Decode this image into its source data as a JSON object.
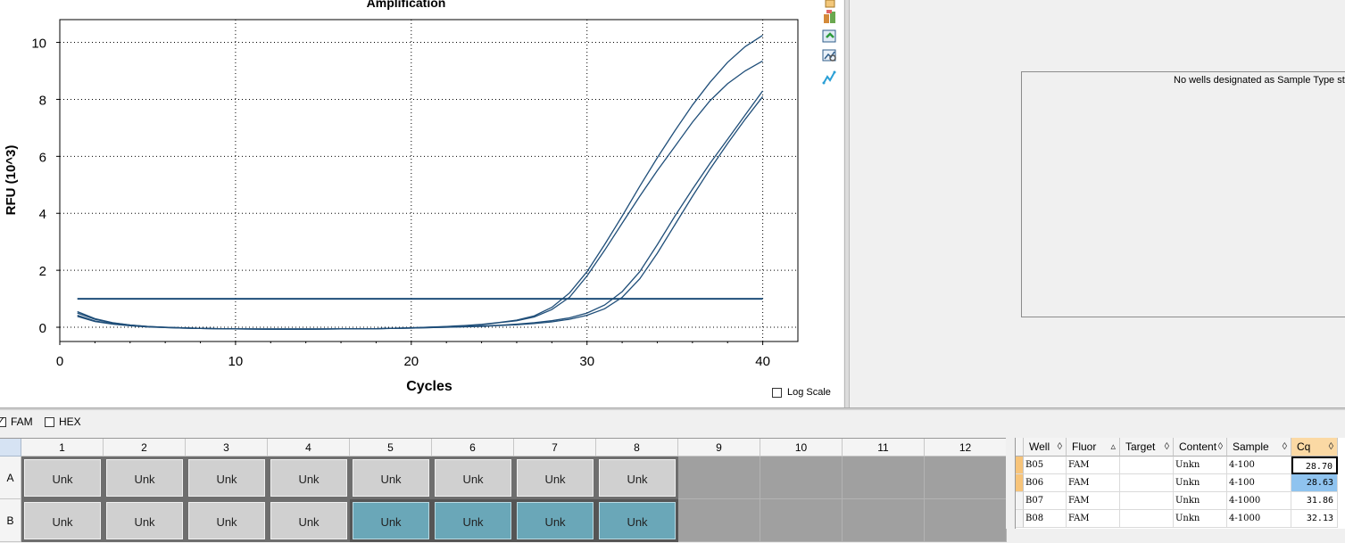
{
  "chart": {
    "title": "Amplification",
    "xlabel": "Cycles",
    "ylabel": "RFU (10^3)",
    "log_scale_label": "Log Scale",
    "log_scale_checked": false
  },
  "chart_data": {
    "type": "line",
    "title": "Amplification",
    "xlabel": "Cycles",
    "ylabel": "RFU (10^3)",
    "xlim": [
      0,
      42
    ],
    "ylim": [
      -0.5,
      10.8
    ],
    "xticks": [
      0,
      10,
      20,
      30,
      40
    ],
    "yticks": [
      0,
      2,
      4,
      6,
      8,
      10
    ],
    "grid": true,
    "threshold": 1.0,
    "line_color": "#1f4e79",
    "series": [
      {
        "x": [
          1,
          2,
          3,
          4,
          5,
          6,
          7,
          8,
          9,
          10,
          12,
          14,
          16,
          18,
          20,
          22,
          23,
          24,
          25,
          26,
          27,
          28,
          29,
          30,
          31,
          32,
          33,
          34,
          35,
          36,
          37,
          38,
          39,
          40
        ],
        "y": [
          0.5,
          0.28,
          0.15,
          0.08,
          0.03,
          0,
          -0.02,
          -0.04,
          -0.05,
          -0.06,
          -0.06,
          -0.06,
          -0.06,
          -0.05,
          -0.02,
          0.03,
          0.06,
          0.1,
          0.17,
          0.25,
          0.4,
          0.7,
          1.2,
          1.95,
          2.9,
          3.9,
          4.95,
          5.95,
          6.9,
          7.8,
          8.6,
          9.3,
          9.85,
          10.25
        ]
      },
      {
        "x": [
          1,
          2,
          3,
          4,
          5,
          6,
          7,
          8,
          9,
          10,
          12,
          14,
          16,
          18,
          20,
          22,
          23,
          24,
          25,
          26,
          27,
          28,
          29,
          30,
          31,
          32,
          33,
          34,
          35,
          36,
          37,
          38,
          39,
          40
        ],
        "y": [
          0.42,
          0.22,
          0.12,
          0.06,
          0.02,
          -0.01,
          -0.03,
          -0.04,
          -0.05,
          -0.06,
          -0.06,
          -0.06,
          -0.06,
          -0.05,
          -0.02,
          0.02,
          0.05,
          0.09,
          0.16,
          0.23,
          0.36,
          0.62,
          1.05,
          1.8,
          2.7,
          3.65,
          4.6,
          5.5,
          6.35,
          7.2,
          7.95,
          8.55,
          9.0,
          9.35
        ]
      },
      {
        "x": [
          1,
          2,
          3,
          4,
          5,
          6,
          7,
          8,
          9,
          10,
          12,
          14,
          16,
          18,
          20,
          22,
          24,
          25,
          26,
          27,
          28,
          29,
          30,
          31,
          32,
          33,
          34,
          35,
          36,
          37,
          38,
          39,
          40
        ],
        "y": [
          0.55,
          0.3,
          0.16,
          0.08,
          0.03,
          0,
          -0.02,
          -0.04,
          -0.05,
          -0.06,
          -0.07,
          -0.07,
          -0.06,
          -0.05,
          -0.03,
          0,
          0.04,
          0.07,
          0.11,
          0.16,
          0.23,
          0.33,
          0.5,
          0.78,
          1.25,
          1.95,
          2.9,
          3.9,
          4.85,
          5.75,
          6.6,
          7.45,
          8.3
        ]
      },
      {
        "x": [
          1,
          2,
          3,
          4,
          5,
          6,
          7,
          8,
          9,
          10,
          12,
          14,
          16,
          18,
          20,
          22,
          24,
          25,
          26,
          27,
          28,
          29,
          30,
          31,
          32,
          33,
          34,
          35,
          36,
          37,
          38,
          39,
          40
        ],
        "y": [
          0.38,
          0.2,
          0.11,
          0.05,
          0.01,
          -0.01,
          -0.03,
          -0.04,
          -0.05,
          -0.06,
          -0.07,
          -0.07,
          -0.06,
          -0.05,
          -0.03,
          0,
          0.03,
          0.06,
          0.09,
          0.13,
          0.19,
          0.28,
          0.42,
          0.65,
          1.05,
          1.7,
          2.6,
          3.6,
          4.6,
          5.55,
          6.45,
          7.3,
          8.1
        ]
      }
    ]
  },
  "toolbar": {
    "icons": [
      "copy-chart-icon",
      "export-chart-icon",
      "chart-settings-icon",
      "curve-tool-icon"
    ]
  },
  "standard_curve": {
    "message": "No wells designated as Sample Type star"
  },
  "fluorophores": [
    {
      "label": "FAM",
      "checked": true
    },
    {
      "label": "HEX",
      "checked": false
    }
  ],
  "plate": {
    "columns": [
      "1",
      "2",
      "3",
      "4",
      "5",
      "6",
      "7",
      "8",
      "9",
      "10",
      "11",
      "12"
    ],
    "rows": [
      {
        "label": "A",
        "wells": [
          "Unk",
          "Unk",
          "Unk",
          "Unk",
          "Unk",
          "Unk",
          "Unk",
          "Unk",
          "",
          "",
          "",
          ""
        ],
        "selected": [
          false,
          false,
          false,
          false,
          false,
          false,
          false,
          false,
          false,
          false,
          false,
          false
        ]
      },
      {
        "label": "B",
        "wells": [
          "Unk",
          "Unk",
          "Unk",
          "Unk",
          "Unk",
          "Unk",
          "Unk",
          "Unk",
          "",
          "",
          "",
          ""
        ],
        "selected": [
          false,
          false,
          false,
          false,
          true,
          true,
          true,
          true,
          false,
          false,
          false,
          false
        ]
      }
    ]
  },
  "results_table": {
    "headers": [
      "Well",
      "Fluor",
      "Target",
      "Content",
      "Sample",
      "Cq"
    ],
    "rows": [
      {
        "well": "B05",
        "fluor": "FAM",
        "target": "",
        "content": "Unkn",
        "sample": "4-100",
        "cq": "28.70"
      },
      {
        "well": "B06",
        "fluor": "FAM",
        "target": "",
        "content": "Unkn",
        "sample": "4-100",
        "cq": "28.63"
      },
      {
        "well": "B07",
        "fluor": "FAM",
        "target": "",
        "content": "Unkn",
        "sample": "4-1000",
        "cq": "31.86"
      },
      {
        "well": "B08",
        "fluor": "FAM",
        "target": "",
        "content": "Unkn",
        "sample": "4-1000",
        "cq": "32.13"
      }
    ]
  }
}
